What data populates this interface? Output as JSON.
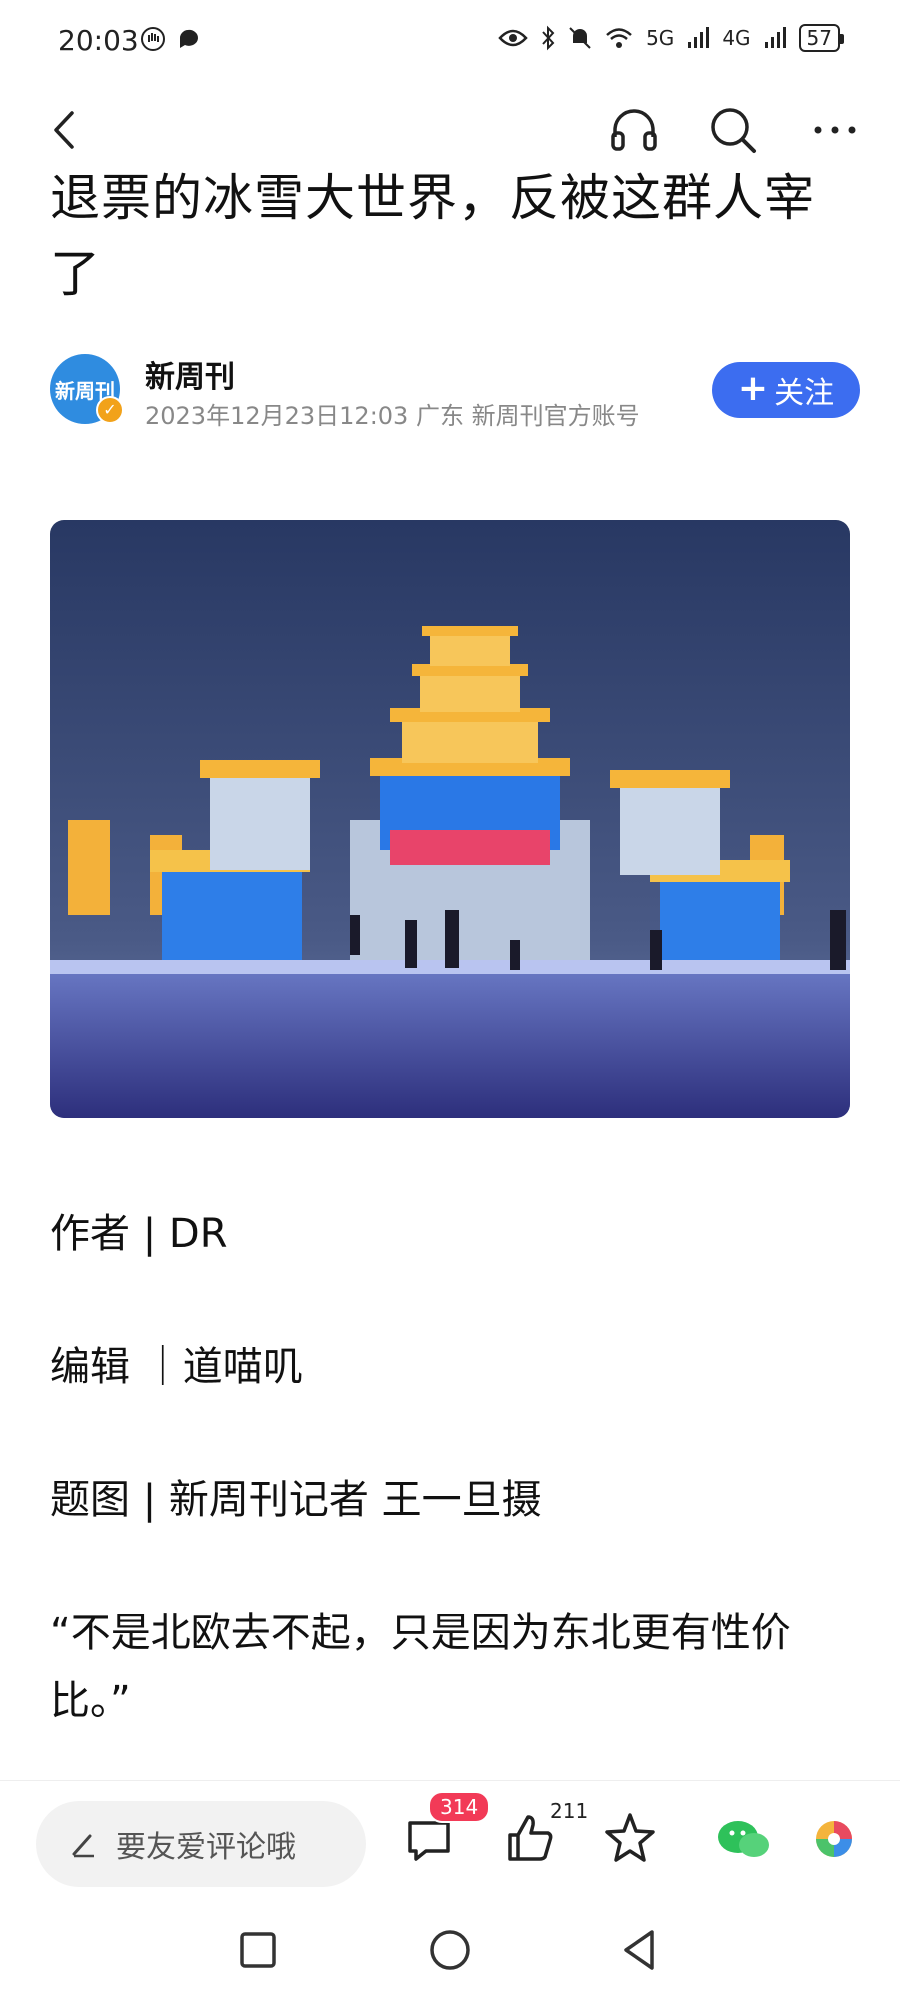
{
  "status_bar": {
    "time": "20:03",
    "network_1": "5G",
    "network_2": "4G",
    "battery": "57"
  },
  "nav": {
    "icons": [
      "back-icon",
      "headphones-icon",
      "search-icon",
      "more-icon"
    ]
  },
  "article": {
    "title": "退票的冰雪大世界，反被这群人宰了",
    "author": {
      "name": "新周刊",
      "avatar_text": "新周刊",
      "meta": "2023年12月23日12:03 广东 新周刊官方账号",
      "follow_label": "关注",
      "follow_plus": "+"
    },
    "paragraphs": [
      "作者 | DR",
      "编辑 ｜道喵叽",
      "题图 | 新周刊记者 王一旦摄",
      "“不是北欧去不起，只是因为东北更有性价比。”"
    ]
  },
  "action_bar": {
    "comment_placeholder": "要友爱评论哦",
    "comment_count": "314",
    "like_count": "211"
  },
  "colors": {
    "accent": "#3c6df0",
    "badge": "#f23a57",
    "verified": "#f2a21a"
  }
}
